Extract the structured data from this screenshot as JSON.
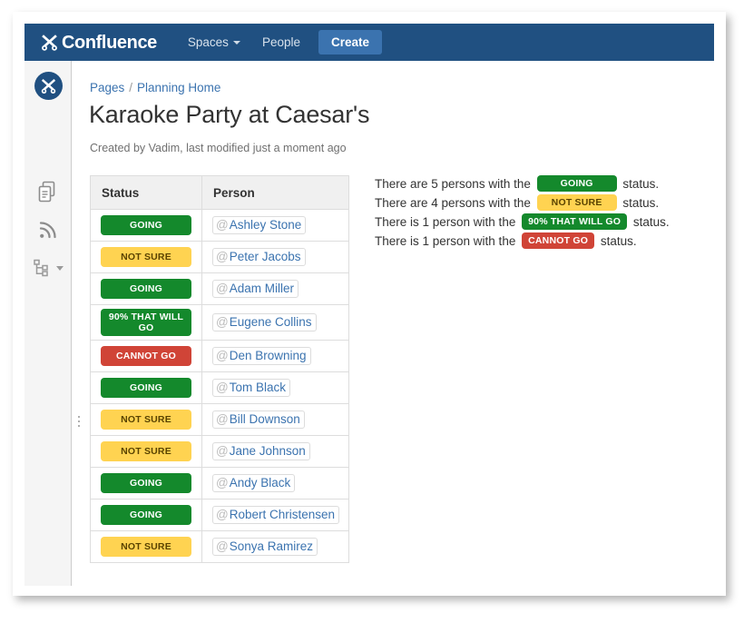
{
  "nav": {
    "brand": "Confluence",
    "brand_icon": "confluence-logo-icon",
    "items": [
      {
        "label": "Spaces",
        "has_caret": true
      },
      {
        "label": "People",
        "has_caret": false
      }
    ],
    "create_label": "Create",
    "background_color": "#205081",
    "create_color": "#3b73af"
  },
  "sidebar": {
    "space_avatar_icon": "confluence-space-avatar",
    "icons": [
      {
        "name": "pages-icon",
        "label": "Pages"
      },
      {
        "name": "rss-feed-icon",
        "label": "Feed"
      },
      {
        "name": "page-tree-icon",
        "label": "Page Tree"
      }
    ]
  },
  "breadcrumb": {
    "items": [
      "Pages",
      "Planning Home"
    ],
    "separator": "/"
  },
  "page": {
    "title": "Karaoke Party at Caesar's",
    "meta": "Created by Vadim, last modified just a moment ago"
  },
  "table": {
    "headers": [
      "Status",
      "Person"
    ],
    "rows": [
      {
        "status": "GOING",
        "status_type": "green",
        "person": "Ashley Stone"
      },
      {
        "status": "NOT SURE",
        "status_type": "yellow",
        "person": "Peter Jacobs"
      },
      {
        "status": "GOING",
        "status_type": "green",
        "person": "Adam Miller"
      },
      {
        "status": "90% THAT WILL GO",
        "status_type": "green",
        "person": "Eugene Collins"
      },
      {
        "status": "CANNOT GO",
        "status_type": "red",
        "person": "Den Browning"
      },
      {
        "status": "GOING",
        "status_type": "green",
        "person": "Tom Black"
      },
      {
        "status": "NOT SURE",
        "status_type": "yellow",
        "person": "Bill Downson"
      },
      {
        "status": "NOT SURE",
        "status_type": "yellow",
        "person": "Jane Johnson"
      },
      {
        "status": "GOING",
        "status_type": "green",
        "person": "Andy Black"
      },
      {
        "status": "GOING",
        "status_type": "green",
        "person": "Robert Christensen"
      },
      {
        "status": "NOT SURE",
        "status_type": "yellow",
        "person": "Sonya Ramirez"
      }
    ]
  },
  "summary": {
    "lines": [
      {
        "prefix": "There are 5 persons with the",
        "status": "GOING",
        "status_type": "green",
        "suffix": "status."
      },
      {
        "prefix": "There are 4 persons with the",
        "status": "NOT SURE",
        "status_type": "yellow",
        "suffix": "status."
      },
      {
        "prefix": "There is 1 person with the",
        "status": "90% THAT WILL GO",
        "status_type": "green",
        "suffix": "status."
      },
      {
        "prefix": "There is 1 person with the",
        "status": "CANNOT GO",
        "status_type": "red",
        "suffix": "status."
      }
    ]
  },
  "colors": {
    "green": "#14892c",
    "yellow": "#ffd351",
    "red": "#d04437",
    "nav_blue": "#205081",
    "link_blue": "#3b73af"
  },
  "mention_prefix": "@"
}
